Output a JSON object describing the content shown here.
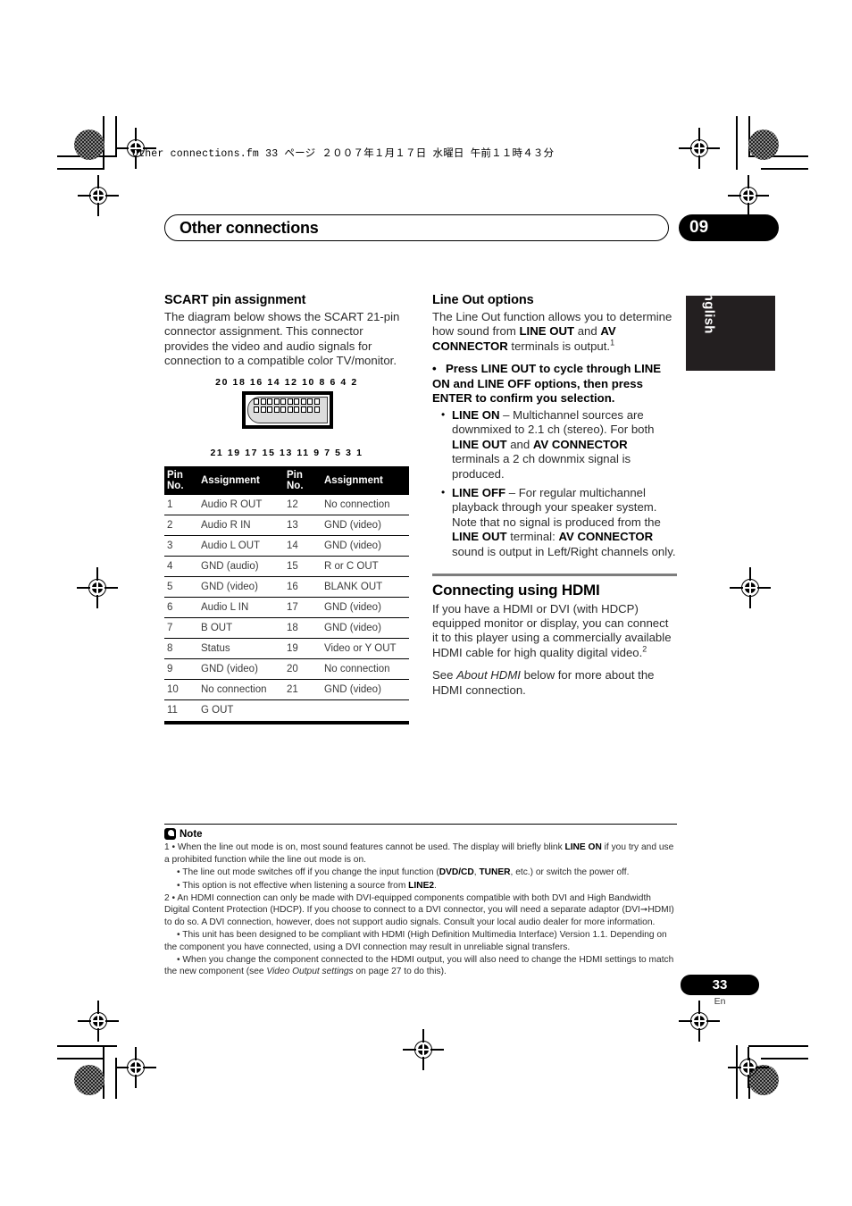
{
  "file_header": "Other connections.fm  33 ページ  ２００７年１月１７日  水曜日  午前１１時４３分",
  "chapter": {
    "title": "Other connections",
    "number": "09"
  },
  "language_tab": "English",
  "left_column": {
    "heading": "SCART pin assignment",
    "intro": "The diagram below shows the SCART 21-pin connector assignment. This connector provides the video and audio signals for connection to a compatible color TV/monitor.",
    "diagram": {
      "top_pins": "20 18 16 14 12 10 8 6 4 2",
      "bottom_pins": "21 19 17 15 13 11 9 7 5 3 1"
    },
    "table": {
      "headers": [
        "Pin No.",
        "Assignment",
        "Pin No.",
        "Assignment"
      ],
      "rows": [
        [
          "1",
          "Audio R OUT",
          "12",
          "No connection"
        ],
        [
          "2",
          "Audio R IN",
          "13",
          "GND (video)"
        ],
        [
          "3",
          "Audio L OUT",
          "14",
          "GND (video)"
        ],
        [
          "4",
          "GND (audio)",
          "15",
          "R or C OUT"
        ],
        [
          "5",
          "GND (video)",
          "16",
          "BLANK OUT"
        ],
        [
          "6",
          "Audio L IN",
          "17",
          "GND (video)"
        ],
        [
          "7",
          "B OUT",
          "18",
          "GND (video)"
        ],
        [
          "8",
          "Status",
          "19",
          "Video or Y OUT"
        ],
        [
          "9",
          "GND (video)",
          "20",
          "No connection"
        ],
        [
          "10",
          "No connection",
          "21",
          "GND (video)"
        ],
        [
          "11",
          "G OUT",
          "",
          ""
        ]
      ]
    }
  },
  "right_column": {
    "line_out": {
      "heading": "Line Out options",
      "intro_1": "The Line Out function allows you to determine how sound from ",
      "intro_bold_1": "LINE OUT",
      "intro_2": " and ",
      "intro_bold_2": "AV CONNECTOR",
      "intro_3": " terminals is output.",
      "intro_footnote": "1",
      "instruction": "Press LINE OUT to cycle through LINE ON and LINE OFF options, then press ENTER to confirm you selection.",
      "options": [
        {
          "label": "LINE ON",
          "text_1": " – Multichannel sources are downmixed to 2.1 ch (stereo). For both ",
          "bold_1": "LINE OUT",
          "text_2": " and ",
          "bold_2": "AV CONNECTOR",
          "text_3": " terminals a 2 ch downmix signal is produced."
        },
        {
          "label": "LINE OFF",
          "text_1": " – For regular multichannel playback through your speaker system. Note that no signal is produced from the ",
          "bold_1": "LINE OUT",
          "text_2": " terminal: ",
          "bold_2": "AV CONNECTOR",
          "text_3": " sound is output in Left/Right channels only."
        }
      ]
    },
    "hdmi": {
      "heading": "Connecting using HDMI",
      "para_1": "If you have a HDMI or DVI (with HDCP) equipped monitor or display, you can connect it to this player using a commercially available HDMI cable for high quality digital video.",
      "para_1_footnote": "2",
      "para_2_pre": "See ",
      "para_2_italic": "About HDMI",
      "para_2_post": " below for more about the HDMI connection."
    }
  },
  "notes": {
    "title": "Note",
    "items": [
      {
        "marker": "1 •",
        "segments": [
          {
            "t": "When the line out mode is on, most sound features cannot be used. The display will briefly blink "
          },
          {
            "t": "LINE ON",
            "b": true
          },
          {
            "t": " if you try and use a prohibited function while the line out mode is on."
          }
        ]
      },
      {
        "marker": "•",
        "indent": true,
        "segments": [
          {
            "t": "The line out mode switches off if you change the input function ("
          },
          {
            "t": "DVD/CD",
            "b": true
          },
          {
            "t": ", "
          },
          {
            "t": "TUNER",
            "b": true
          },
          {
            "t": ", etc.) or switch the power off."
          }
        ]
      },
      {
        "marker": "•",
        "indent": true,
        "segments": [
          {
            "t": "This option is not effective when listening a source from "
          },
          {
            "t": "LINE2",
            "b": true
          },
          {
            "t": "."
          }
        ]
      },
      {
        "marker": "2 •",
        "segments": [
          {
            "t": "An HDMI connection can only be made with DVI-equipped components compatible with both DVI and High Bandwidth Digital Content Protection (HDCP). If you choose to connect to a DVI connector, you will need a separate adaptor (DVI➞HDMI) to do so. A DVI connection, however, does not support audio signals. Consult your local audio dealer for more information."
          }
        ]
      },
      {
        "marker": "•",
        "indent": true,
        "segments": [
          {
            "t": "This unit has been designed to be compliant with HDMI (High Definition Multimedia Interface) Version 1.1. Depending on the component you have connected, using a DVI connection may result in unreliable signal transfers."
          }
        ]
      },
      {
        "marker": "•",
        "indent": true,
        "segments": [
          {
            "t": "When you change the component connected to the HDMI output, you will also need to change the HDMI settings to match the new component (see "
          },
          {
            "t": "Video Output settings",
            "i": true
          },
          {
            "t": " on page 27 to do this)."
          }
        ]
      }
    ]
  },
  "footer": {
    "page_number": "33",
    "page_language": "En"
  }
}
